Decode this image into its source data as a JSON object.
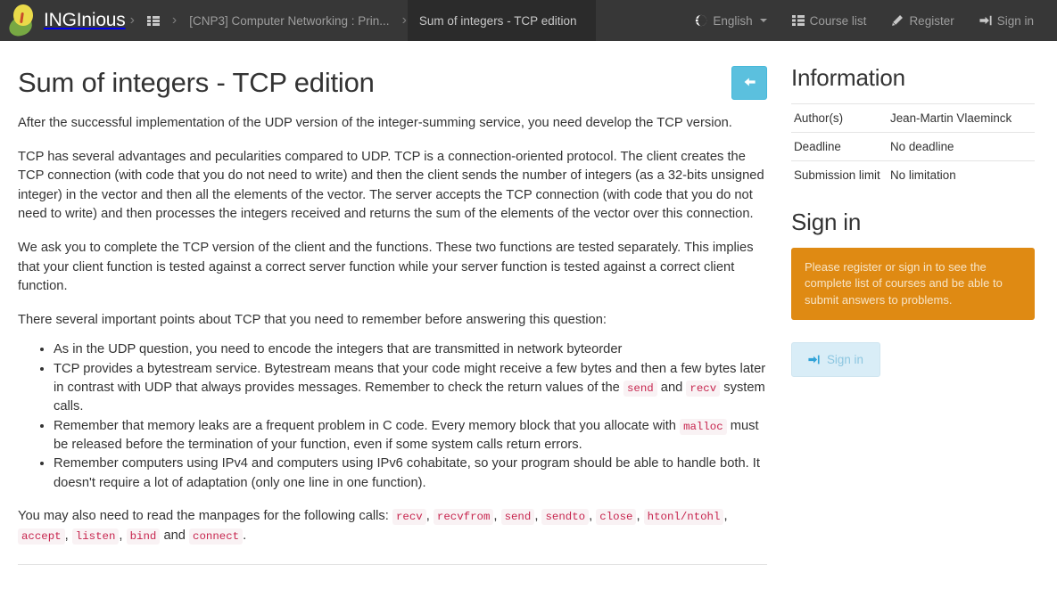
{
  "navbar": {
    "brand": "INGInious",
    "logo_icon": "inginious-bulb-logo",
    "courses_grid_icon": "course-grid-icon",
    "breadcrumbs": [
      {
        "label": "[CNP3] Computer Networking : Prin...",
        "active": false
      },
      {
        "label": "Sum of integers - TCP edition",
        "active": true
      }
    ],
    "right_items": [
      {
        "label": "English",
        "icon": "globe-icon",
        "has_caret": true
      },
      {
        "label": "Course list",
        "icon": "list-icon",
        "has_caret": false
      },
      {
        "label": "Register",
        "icon": "pencil-icon",
        "has_caret": false
      },
      {
        "label": "Sign in",
        "icon": "sign-in-icon",
        "has_caret": false
      }
    ]
  },
  "main": {
    "title": "Sum of integers - TCP edition",
    "back_button_icon": "arrow-left-icon",
    "paragraphs": {
      "p1": "After the successful implementation of the UDP version of the integer-summing service, you need develop the TCP version.",
      "p2": "TCP has several advantages and pecularities compared to UDP. TCP is a connection-oriented protocol. The client creates the TCP connection (with code that you do not need to write) and then the client sends the number of integers (as a 32-bits unsigned integer) in the vector and then all the elements of the vector. The server accepts the TCP connection (with code that you do not need to write) and then processes the integers received and returns the sum of the elements of the vector over this connection.",
      "p3": "We ask you to complete the TCP version of the client and the functions. These two functions are tested separately. This implies that your client function is tested against a correct server function while your server function is tested against a correct client function.",
      "p4": "There several important points about TCP that you need to remember before answering this question:"
    },
    "bullets": {
      "b1": "As in the UDP question, you need to encode the integers that are transmitted in network byteorder",
      "b2_part1": "TCP provides a bytestream service. Bytestream means that your code might receive a few bytes and then a few bytes later in contrast with UDP that always provides messages. Remember to check the return values of the",
      "b2_code1": "send",
      "b2_mid": "and",
      "b2_code2": "recv",
      "b2_part2": "system calls.",
      "b3_part1": "Remember that memory leaks are a frequent problem in C code. Every memory block that you allocate with",
      "b3_code": "malloc",
      "b3_part2": "must be released before the termination of your function, even if some system calls return errors.",
      "b4": "Remember computers using IPv4 and computers using IPv6 cohabitate, so your program should be able to handle both. It doesn't require a lot of adaptation (only one line in one function)."
    },
    "manpages": {
      "lead": "You may also need to read the manpages for the following calls:",
      "calls": [
        "recv",
        "recvfrom",
        "send",
        "sendto",
        "close",
        "htonl/ntohl",
        "accept",
        "listen",
        "bind",
        "connect"
      ],
      "conjunction": "and"
    }
  },
  "sidebar": {
    "information_title": "Information",
    "info_rows": [
      {
        "key": "Author(s)",
        "value": "Jean-Martin Vlaeminck"
      },
      {
        "key": "Deadline",
        "value": "No deadline"
      },
      {
        "key": "Submission limit",
        "value": "No limitation"
      }
    ],
    "signin_title": "Sign in",
    "alert_text": "Please register or sign in to see the complete list of courses and be able to submit answers to problems.",
    "signin_button_label": "Sign in",
    "signin_button_icon": "sign-in-icon"
  },
  "colors": {
    "navbar_bg": "#373737",
    "navbar_active_bg": "#2b2b2b",
    "info_blue": "#5bc0de",
    "alert_orange": "#df8a13",
    "code_pink": "#c7254e",
    "code_bg": "#f9f2f4",
    "signin_btn_bg": "#d9edf7"
  }
}
